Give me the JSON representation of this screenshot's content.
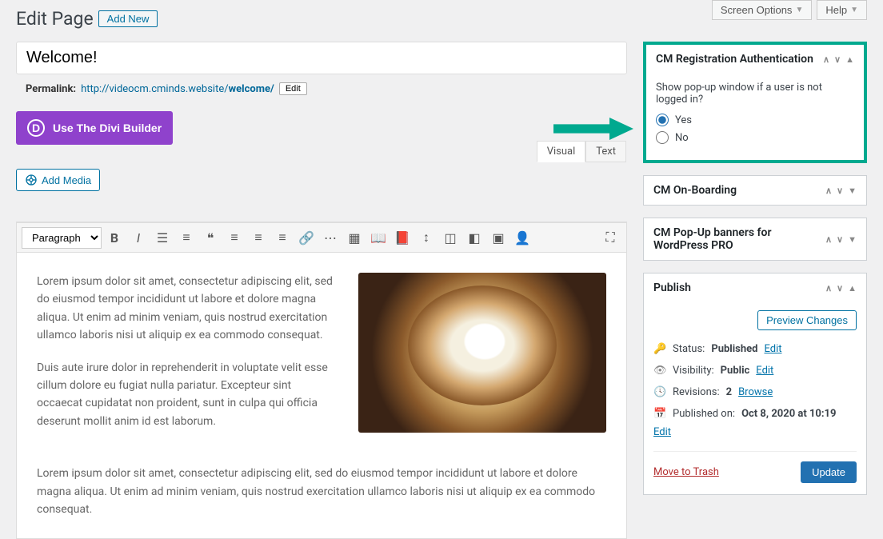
{
  "top": {
    "screen_options": "Screen Options",
    "help": "Help"
  },
  "header": {
    "title": "Edit Page",
    "add_new": "Add New"
  },
  "post": {
    "title": "Welcome!",
    "permalink_label": "Permalink:",
    "permalink_url": "http://videocm.cminds.website/",
    "permalink_slug": "welcome/",
    "edit_label": "Edit"
  },
  "divi": {
    "label": "Use The Divi Builder",
    "icon_letter": "D"
  },
  "editor": {
    "add_media": "Add Media",
    "tabs": {
      "visual": "Visual",
      "text": "Text"
    },
    "format_selected": "Paragraph",
    "content": {
      "p1": "Lorem ipsum dolor sit amet, consectetur adipiscing elit, sed do eiusmod tempor incididunt ut labore et dolore magna aliqua. Ut enim ad minim veniam, quis nostrud exercitation ullamco laboris nisi ut aliquip ex ea commodo consequat.",
      "p2": "Duis aute irure dolor in reprehenderit in voluptate velit esse cillum dolore eu fugiat nulla pariatur. Excepteur sint occaecat cupidatat non proident, sunt in culpa qui officia deserunt mollit anim id est laborum.",
      "p3": "Lorem ipsum dolor sit amet, consectetur adipiscing elit, sed do eiusmod tempor incididunt ut labore et dolore magna aliqua. Ut enim ad minim veniam, quis nostrud exercitation ullamco laboris nisi ut aliquip ex ea commodo consequat."
    }
  },
  "boxes": {
    "cm_reg": {
      "title": "CM Registration Authentication",
      "question": "Show pop-up window if a user is not logged in?",
      "yes": "Yes",
      "no": "No"
    },
    "cm_onboarding": "CM On-Boarding",
    "cm_popup": "CM Pop-Up banners for WordPress PRO",
    "publish": {
      "title": "Publish",
      "preview": "Preview Changes",
      "status_label": "Status:",
      "status_value": "Published",
      "visibility_label": "Visibility:",
      "visibility_value": "Public",
      "revisions_label": "Revisions:",
      "revisions_count": "2",
      "browse": "Browse",
      "published_label": "Published on:",
      "published_value": "Oct 8, 2020 at 10:19",
      "edit": "Edit",
      "trash": "Move to Trash",
      "update": "Update"
    }
  }
}
